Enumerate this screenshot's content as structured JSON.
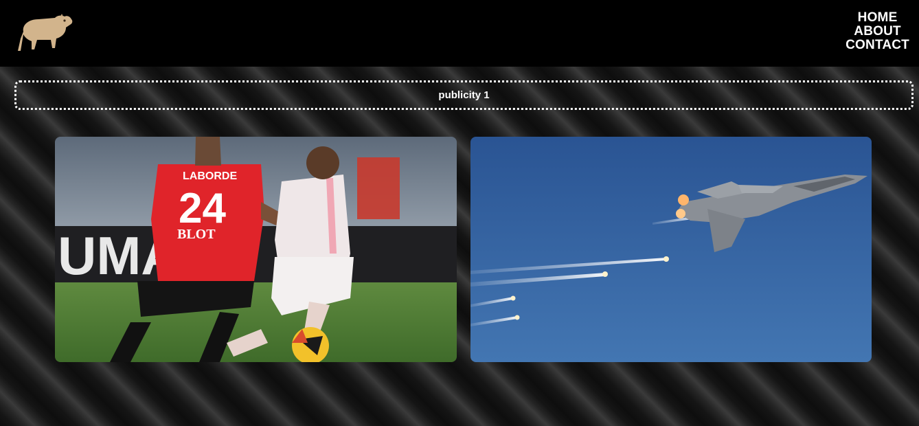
{
  "header": {
    "logo_icon": "capybara-logo-icon",
    "nav": {
      "home": "HOME",
      "about": "ABOUT",
      "contact": "CONTACT"
    }
  },
  "publicity": {
    "label": "publicity 1"
  },
  "gallery": {
    "images": [
      {
        "subject": "soccer-match-photo",
        "jersey_name": "LABORDE",
        "jersey_number": "24",
        "sponsor": "BLOT"
      },
      {
        "subject": "fighter-jet-flares-photo"
      }
    ]
  },
  "colors": {
    "header_bg": "#000000",
    "text": "#ffffff",
    "logo": "#d2b48c"
  }
}
